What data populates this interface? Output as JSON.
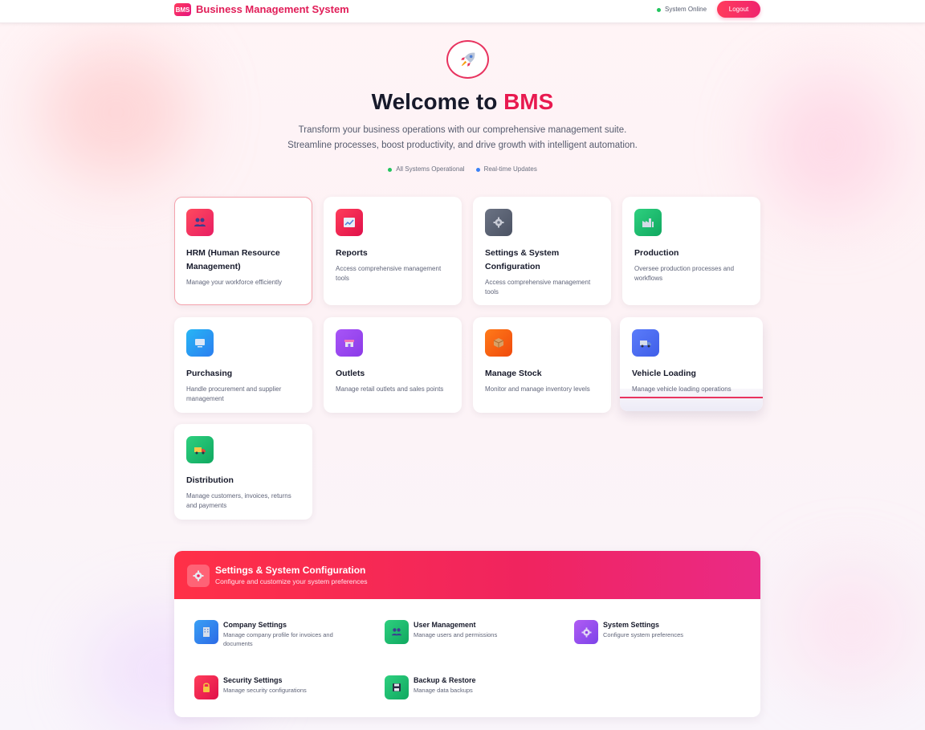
{
  "header": {
    "logo_text": "BMS",
    "brand": "Business Management System",
    "status_label": "System Online",
    "logout_label": "Logout"
  },
  "hero": {
    "icon": "rocket-icon",
    "title_prefix": "Welcome to ",
    "title_accent": "BMS",
    "subtitle_line1": "Transform your business operations with our comprehensive management suite.",
    "subtitle_line2": "Streamline processes, boost productivity, and drive growth with intelligent automation.",
    "status": [
      {
        "label": "All Systems Operational",
        "color": "#22c55e"
      },
      {
        "label": "Real-time Updates",
        "color": "#3b82f6"
      }
    ]
  },
  "modules": [
    {
      "title": "HRM (Human Resource Management)",
      "desc": "Manage your workforce efficiently",
      "icon": "users-icon",
      "color": "#e81e63",
      "selected": true
    },
    {
      "title": "Reports",
      "desc": "Access comprehensive management tools",
      "icon": "chart-icon",
      "color": "#e0104a"
    },
    {
      "title": "Settings & System Configuration",
      "desc": "Access comprehensive management tools",
      "icon": "gear-icon",
      "color": "#4b5263"
    },
    {
      "title": "Production",
      "desc": "Oversee production processes and workflows",
      "icon": "factory-icon",
      "color": "#10a860"
    },
    {
      "title": "Purchasing",
      "desc": "Handle procurement and supplier management",
      "icon": "computer-icon",
      "color": "#2b7ef0"
    },
    {
      "title": "Outlets",
      "desc": "Manage retail outlets and sales points",
      "icon": "store-icon",
      "color": "#8b3be8"
    },
    {
      "title": "Manage Stock",
      "desc": "Monitor and manage inventory levels",
      "icon": "box-icon",
      "color": "#f04a0c"
    },
    {
      "title": "Vehicle Loading",
      "desc": "Manage vehicle loading operations",
      "icon": "truck-icon",
      "color": "#3f5ee8",
      "hovered": true
    },
    {
      "title": "Distribution",
      "desc": "Manage customers, invoices, returns and payments",
      "icon": "delivery-truck-icon",
      "color": "#10a860"
    }
  ],
  "settings_panel": {
    "title": "Settings & System Configuration",
    "subtitle": "Configure and customize your system preferences",
    "icon": "gear-icon",
    "items": [
      {
        "title": "Company Settings",
        "desc": "Manage company profile for invoices and documents",
        "icon": "building-icon",
        "color": "#2c6ae6"
      },
      {
        "title": "User Management",
        "desc": "Manage users and permissions",
        "icon": "users-icon",
        "color": "#10a860"
      },
      {
        "title": "System Settings",
        "desc": "Configure system preferences",
        "icon": "gear-icon",
        "color": "#7c43e8"
      },
      {
        "title": "Security Settings",
        "desc": "Manage security configurations",
        "icon": "lock-icon",
        "color": "#e0104a"
      },
      {
        "title": "Backup & Restore",
        "desc": "Manage data backups",
        "icon": "floppy-disk-icon",
        "color": "#10a860"
      }
    ]
  }
}
